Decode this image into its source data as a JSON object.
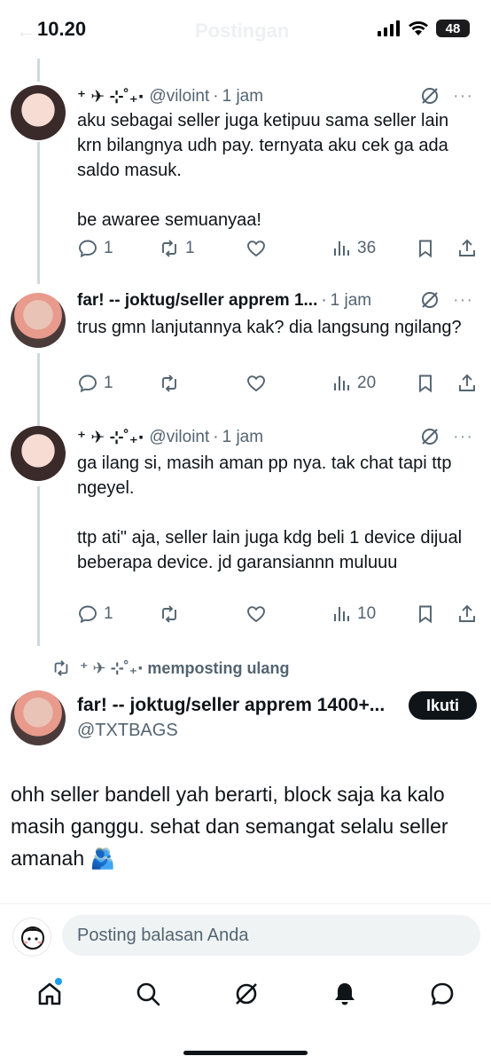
{
  "status_bar": {
    "time": "10.20",
    "battery": "48",
    "header_title": "Postingan"
  },
  "replies": [
    {
      "name": "⁺ ✈︎ ⊹˚₊‧",
      "handle": "@viloint",
      "time": "1 jam",
      "text": "aku sebagai seller juga ketipuu sama seller lain krn bilangnya udh pay. ternyata aku cek ga ada saldo masuk.\n\nbe awaree semuanyaa!",
      "replies": "1",
      "reposts": "1",
      "views": "36"
    },
    {
      "name": "far! -- joktug/seller apprem 1...",
      "handle": "",
      "time": "1 jam",
      "text": "trus gmn lanjutannya kak? dia langsung ngilang?",
      "replies": "1",
      "reposts": "",
      "views": "20"
    },
    {
      "name": "⁺ ✈︎ ⊹˚₊‧",
      "handle": "@viloint",
      "time": "1 jam",
      "text": "ga ilang si, masih aman pp nya. tak chat tapi ttp ngeyel.\n\nttp ati\" aja, seller lain juga kdg beli 1 device dijual beberapa device. jd garansiannn muluuu",
      "replies": "1",
      "reposts": "",
      "views": "10"
    }
  ],
  "repost_banner": {
    "label": "⁺ ✈︎ ⊹˚₊‧ memposting ulang"
  },
  "main_post": {
    "name": "far! -- joktug/seller apprem 1400+...",
    "handle": "@TXTBAGS",
    "follow_label": "Ikuti",
    "text": "ohh seller bandell yah berarti, block saja ka kalo masih ganggu. sehat dan semangat selalu seller amanah 🫂"
  },
  "reply_bar": {
    "placeholder": "Posting balasan Anda"
  },
  "colors": {
    "text": "#0f1419",
    "muted": "#536471",
    "accent": "#1d9bf0",
    "thread_line": "#cfd9de"
  }
}
